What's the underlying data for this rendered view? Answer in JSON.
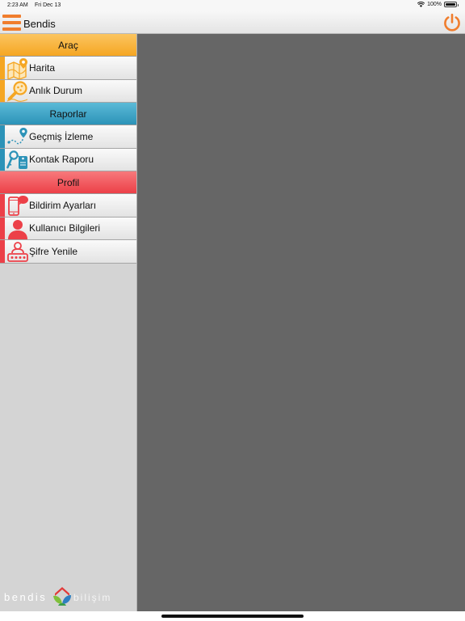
{
  "status_bar": {
    "time": "2:23 AM",
    "date": "Fri Dec 13",
    "battery": "100%"
  },
  "nav_bar": {
    "title": "Bendis"
  },
  "colors": {
    "accent_orange": "#f07d2d",
    "arac": "#f5a623",
    "raporlar": "#2c93b8",
    "profil": "#ec4048",
    "content_background": "#666666"
  },
  "sidebar": {
    "sections": [
      {
        "title": "Araç",
        "items": [
          {
            "label": "Harita",
            "icon": "map-pin-icon"
          },
          {
            "label": "Anlık Durum",
            "icon": "magnifier-icon"
          }
        ]
      },
      {
        "title": "Raporlar",
        "items": [
          {
            "label": "Geçmiş İzleme",
            "icon": "route-pin-icon"
          },
          {
            "label": "Kontak Raporu",
            "icon": "key-tag-icon"
          }
        ]
      },
      {
        "title": "Profil",
        "items": [
          {
            "label": "Bildirim Ayarları",
            "icon": "phone-notification-icon"
          },
          {
            "label": "Kullanıcı Bilgileri",
            "icon": "user-icon"
          },
          {
            "label": "Şifre Yenile",
            "icon": "user-password-icon"
          }
        ]
      }
    ]
  },
  "brand": {
    "left": "bendis",
    "right": "bilişim"
  }
}
